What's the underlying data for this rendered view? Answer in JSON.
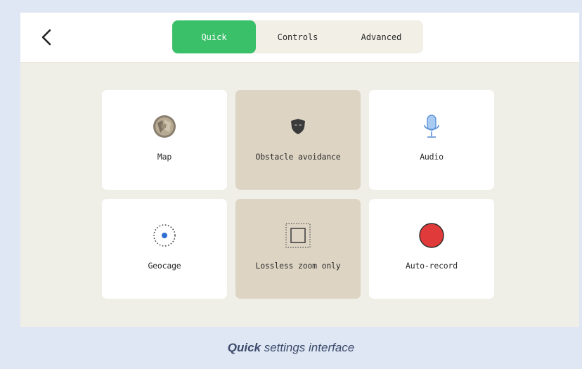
{
  "header": {
    "tabs": [
      {
        "label": "Quick",
        "active": true
      },
      {
        "label": "Controls",
        "active": false
      },
      {
        "label": "Advanced",
        "active": false
      }
    ],
    "back_icon": "chevron-left-icon"
  },
  "tiles": [
    {
      "label": "Map",
      "icon": "map-icon",
      "selected": false
    },
    {
      "label": "Obstacle avoidance",
      "icon": "shield-icon",
      "selected": true
    },
    {
      "label": "Audio",
      "icon": "microphone-icon",
      "selected": false
    },
    {
      "label": "Geocage",
      "icon": "geocage-icon",
      "selected": false
    },
    {
      "label": "Lossless zoom only",
      "icon": "zoom-frame-icon",
      "selected": true
    },
    {
      "label": "Auto-record",
      "icon": "record-icon",
      "selected": false
    }
  ],
  "caption": {
    "bold": "Quick",
    "rest": " settings interface"
  },
  "colors": {
    "accent": "#3bc06a",
    "selected_tile": "#ddd4c3",
    "record_red": "#e03a3a",
    "mic_blue": "#6fa7e8"
  }
}
